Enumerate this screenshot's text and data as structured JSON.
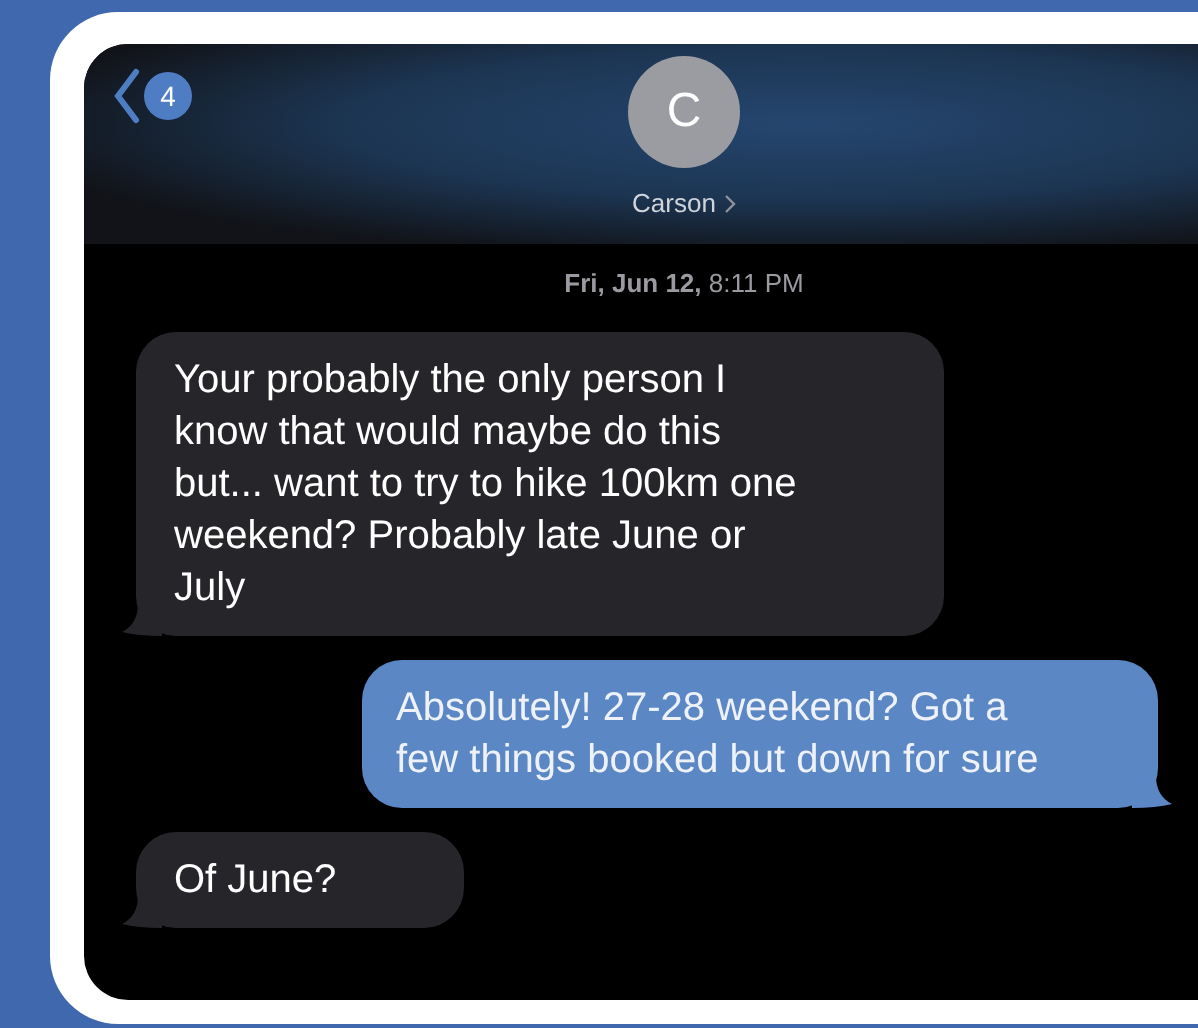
{
  "header": {
    "back_count": "4",
    "avatar_initial": "C",
    "contact_name": "Carson"
  },
  "timestamp": "**Fri, Jun 12,** 8:11 PM",
  "messages": [
    {
      "kind": "incoming",
      "text": "Your probably the only person I know that would maybe do this but... want to try to hike 100km one weekend? Probably late June or July"
    },
    {
      "kind": "outgoing",
      "text": "Absolutely! 27-28 weekend? Got a few things booked but down for sure"
    },
    {
      "kind": "incoming",
      "text": "Of June?"
    }
  ]
}
